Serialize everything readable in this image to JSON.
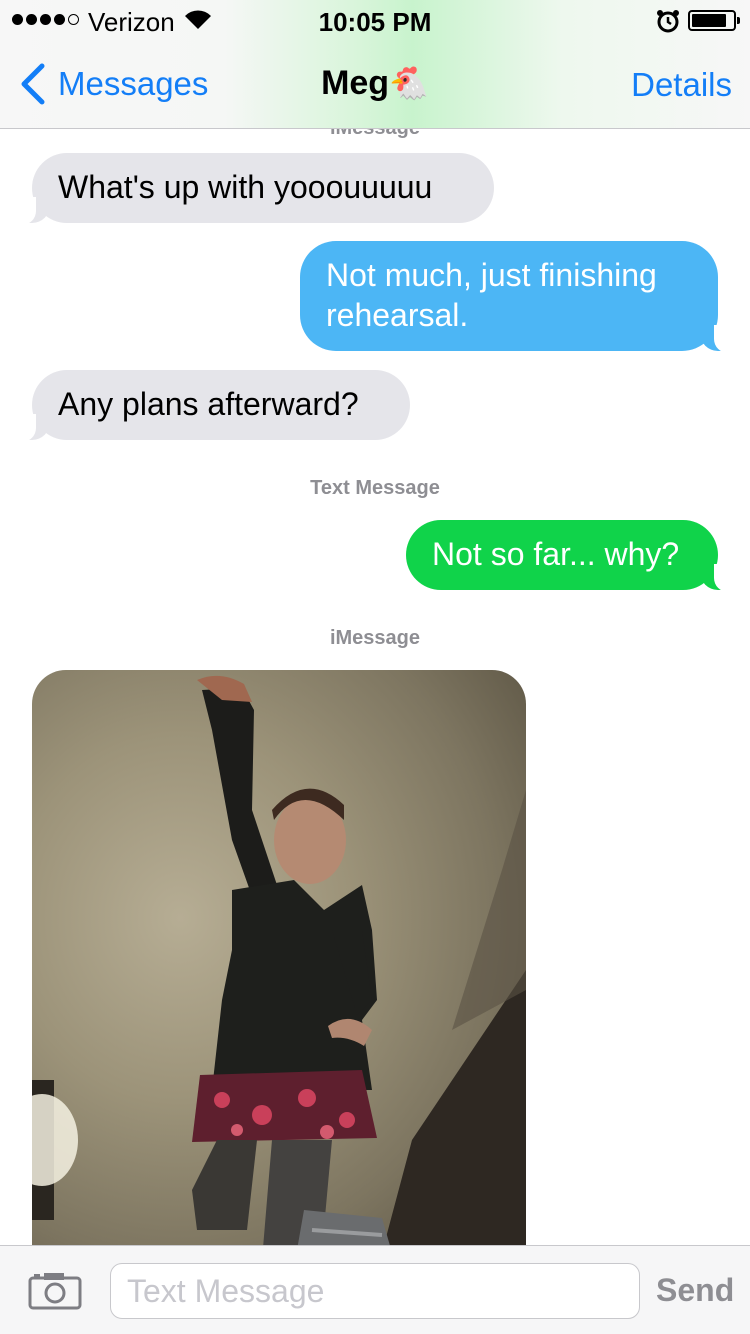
{
  "status_bar": {
    "carrier": "Verizon",
    "time": "10:05 PM",
    "signal_bars_filled": 4,
    "signal_bars_total": 5
  },
  "nav": {
    "back_label": "Messages",
    "title": "Meg",
    "title_emoji": "🐔",
    "details_label": "Details"
  },
  "conversation": {
    "cut_label": "iMessage",
    "messages": [
      {
        "side": "incoming",
        "text": "What's up with yooouuuuu"
      },
      {
        "side": "outgoing",
        "service": "iMessage",
        "line1": "Not much, just finishing",
        "line2": "rehearsal."
      },
      {
        "side": "incoming",
        "text": "Any plans afterward?"
      },
      {
        "side": "outgoing",
        "service": "Text Message",
        "text": "Not so far... why?"
      }
    ],
    "timestamps": [
      "Text Message",
      "iMessage"
    ]
  },
  "input": {
    "placeholder": "Text Message",
    "send_label": "Send"
  },
  "colors": {
    "link_blue": "#137ef7",
    "imessage_blue": "#4cb6f5",
    "sms_green": "#10d34a",
    "incoming_gray": "#e5e5ea"
  },
  "icons": {
    "back": "chevron-left-icon",
    "camera": "camera-icon",
    "wifi": "wifi-icon",
    "alarm": "alarm-clock-icon",
    "battery": "battery-icon"
  }
}
